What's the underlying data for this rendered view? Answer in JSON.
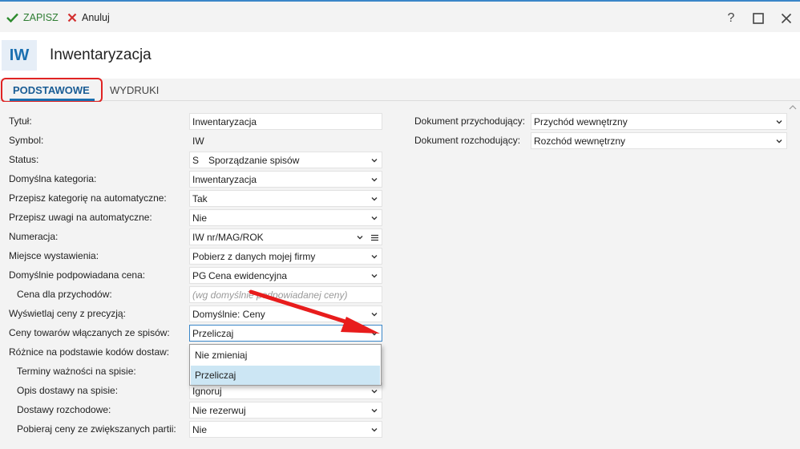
{
  "toolbar": {
    "save_label": "ZAPISZ",
    "cancel_label": "Anuluj"
  },
  "window": {
    "help_glyph": "?"
  },
  "header": {
    "badge": "IW",
    "title": "Inwentaryzacja"
  },
  "tabs": [
    {
      "label": "PODSTAWOWE",
      "active": true
    },
    {
      "label": "WYDRUKI",
      "active": false
    }
  ],
  "form_left": [
    {
      "label": "Tytuł:",
      "value": "Inwentaryzacja",
      "kind": "text"
    },
    {
      "label": "Symbol:",
      "value": "IW",
      "kind": "readonly"
    },
    {
      "label": "Status:",
      "code": "S",
      "value": "Sporządzanie spisów",
      "kind": "select"
    },
    {
      "label": "Domyślna kategoria:",
      "value": "Inwentaryzacja",
      "kind": "select"
    },
    {
      "label": "Przepisz kategorię na automatyczne:",
      "value": "Tak",
      "kind": "select"
    },
    {
      "label": "Przepisz uwagi na automatyczne:",
      "value": "Nie",
      "kind": "select"
    },
    {
      "label": "Numeracja:",
      "value": "IW nr/MAG/ROK",
      "kind": "select-menu"
    },
    {
      "label": "Miejsce wystawienia:",
      "value": "Pobierz z danych mojej firmy",
      "kind": "select"
    },
    {
      "label": "Domyślnie podpowiadana cena:",
      "code": "PG",
      "value": "Cena ewidencyjna",
      "kind": "select"
    },
    {
      "label": "Cena dla przychodów:",
      "value": "(wg domyślnie podpowiadanej ceny)",
      "kind": "placeholder"
    },
    {
      "label": "Wyświetlaj ceny z precyzją:",
      "value": "Domyślnie: Ceny",
      "kind": "select"
    },
    {
      "label": "Ceny towarów włączanych ze spisów:",
      "value": "Przeliczaj",
      "kind": "select-focused"
    },
    {
      "label": "Różnice na podstawie kodów dostaw:",
      "value": "",
      "kind": "hidden"
    },
    {
      "label": "Terminy ważności na spisie:",
      "value": "",
      "kind": "hidden"
    },
    {
      "label": "Opis dostawy na spisie:",
      "value": "Ignoruj",
      "kind": "select"
    },
    {
      "label": "Dostawy rozchodowe:",
      "value": "Nie rezerwuj",
      "kind": "select"
    },
    {
      "label": "Pobieraj ceny ze zwiększanych partii:",
      "value": "Nie",
      "kind": "select"
    }
  ],
  "form_right": [
    {
      "label": "Dokument przychodujący:",
      "value": "Przychód wewnętrzny",
      "kind": "select"
    },
    {
      "label": "Dokument rozchodujący:",
      "value": "Rozchód wewnętrzny",
      "kind": "select"
    }
  ],
  "dropdown": {
    "options": [
      {
        "label": "Nie zmieniaj",
        "selected": false
      },
      {
        "label": "Przeliczaj",
        "selected": true
      }
    ]
  },
  "colors": {
    "accent": "#1a6fb0",
    "save_check": "#2e8b2e",
    "cancel_x": "#d32f2f",
    "highlight": "#e02424",
    "selected_option": "#cce6f4"
  }
}
